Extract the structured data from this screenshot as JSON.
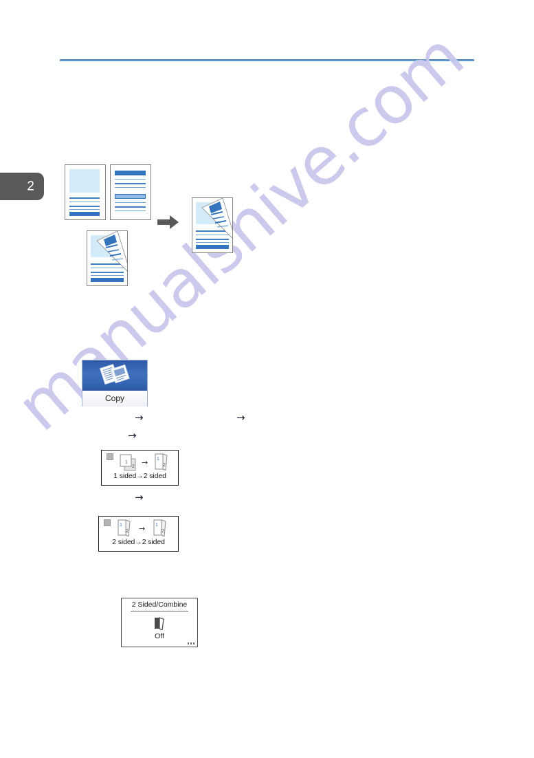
{
  "document": {
    "chapter_number": "2",
    "watermark": "manualshive.com"
  },
  "colors": {
    "rule": "#5b95c8",
    "chapter_tab": "#595959",
    "accent_blue": "#3f7fc1",
    "image_block": "#d3ebf8",
    "copy_button_top": "#3667b4",
    "watermark": "#c9c8ec",
    "arrow_gray": "#595959"
  },
  "illustration": {
    "name": "duplex-copy-illustration",
    "arrow": "→",
    "sheets": [
      {
        "name": "original-page-1",
        "kind": "flat-with-image"
      },
      {
        "name": "original-page-2",
        "kind": "flat-with-bars"
      },
      {
        "name": "duplex-original",
        "kind": "folded"
      },
      {
        "name": "duplex-result",
        "kind": "folded"
      }
    ]
  },
  "copy_button": {
    "label": "Copy",
    "icon": "copy-documents-icon"
  },
  "step_arrows": [
    {
      "name": "step-arrow-1",
      "glyph": "→"
    },
    {
      "name": "step-arrow-2",
      "glyph": "→"
    },
    {
      "name": "step-arrow-3",
      "glyph": "→"
    },
    {
      "name": "step-arrow-4",
      "glyph": "→"
    }
  ],
  "option_panels": [
    {
      "name": "option-1-sided-to-2-sided",
      "caption": "1 sided→2 sided",
      "mini_arrow": "→",
      "checkbox": "unselected"
    },
    {
      "name": "option-2-sided-to-2-sided",
      "caption": "2 sided→2 sided",
      "mini_arrow": "→",
      "checkbox": "unselected"
    }
  ],
  "screen_panel": {
    "title": "2 Sided/Combine",
    "status": "Off",
    "icon": "duplex-sheet-icon",
    "overflow_dots": "..."
  }
}
